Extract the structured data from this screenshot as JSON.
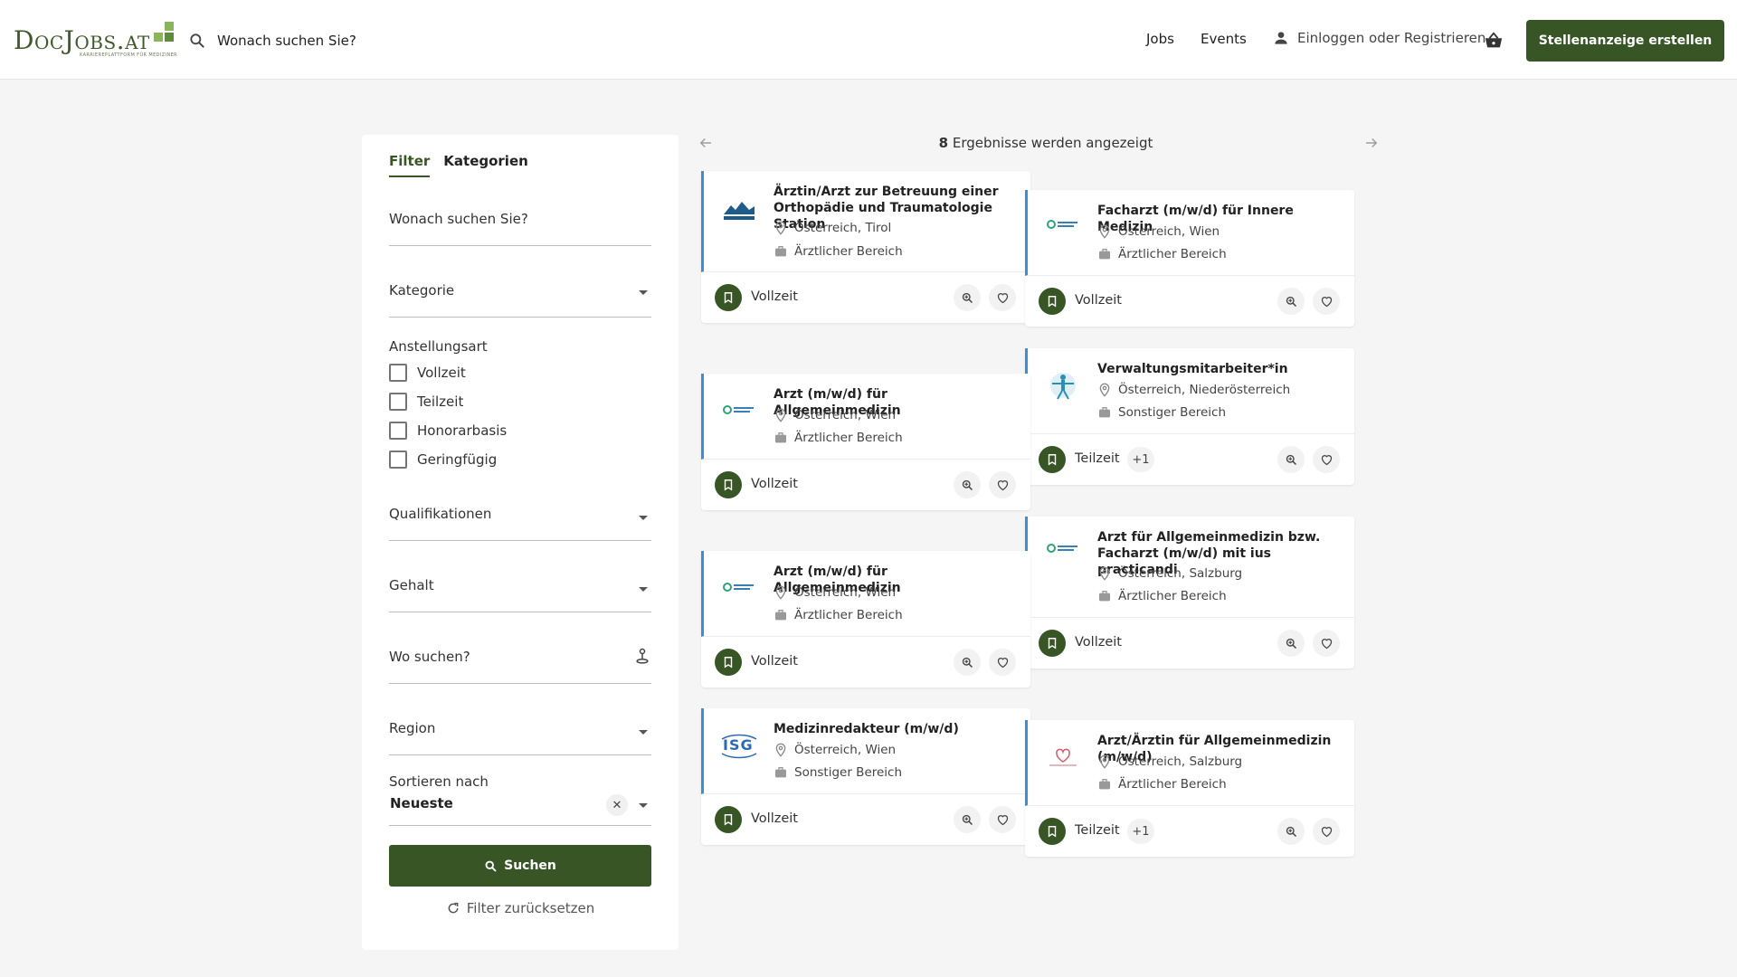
{
  "header": {
    "logo_text": "DocJobs.at",
    "logo_tagline": "KARRIEREPLATTFORM FÜR MEDIZINER",
    "search_placeholder": "Wonach suchen Sie?",
    "nav_jobs": "Jobs",
    "nav_events": "Events",
    "login": "Einloggen oder Registrieren",
    "cta": "Stellenanzeige erstellen"
  },
  "filter": {
    "tabs": [
      "Filter",
      "Kategorien"
    ],
    "search_placeholder": "Wonach suchen Sie?",
    "kategorie": "Kategorie",
    "anstellungsart_label": "Anstellungsart",
    "anstellungsart_options": [
      "Vollzeit",
      "Teilzeit",
      "Honorarbasis",
      "Geringfügig"
    ],
    "qualifikationen": "Qualifikationen",
    "gehalt": "Gehalt",
    "wo_suchen": "Wo suchen?",
    "region": "Region",
    "sort_label": "Sortieren nach",
    "sort_value": "Neueste",
    "search_button": "Suchen",
    "reset": "Filter zurücksetzen"
  },
  "results": {
    "count": "8",
    "count_text": " Ergebnisse werden angezeigt"
  },
  "jobs": [
    {
      "title": "Ärztin/Arzt zur Betreuung einer Orthopädie und Traumatologie Station",
      "location": "Österreich, Tirol",
      "category": "Ärztlicher Bereich",
      "type": "Vollzeit",
      "extra": "",
      "logo": "tirol-kliniken-logo"
    },
    {
      "title": "Facharzt (m/w/d) für Innere Medizin",
      "location": "Österreich, Wien",
      "category": "Ärztlicher Bereich",
      "type": "Vollzeit",
      "extra": "",
      "logo": "green-ring-logo"
    },
    {
      "title": "Verwaltungsmitarbeiter*in",
      "location": "Österreich, Niederösterreich",
      "category": "Sonstiger Bereich",
      "type": "Teilzeit",
      "extra": "+1",
      "logo": "vitruvian-logo"
    },
    {
      "title": "Arzt (m/w/d) für Allgemeinmedizin",
      "location": "Österreich, Wien",
      "category": "Ärztlicher Bereich",
      "type": "Vollzeit",
      "extra": "",
      "logo": "green-ring-logo"
    },
    {
      "title": "Arzt für Allgemeinmedizin bzw. Facharzt (m/w/d) mit ius practicandi",
      "location": "Österreich, Salzburg",
      "category": "Ärztlicher Bereich",
      "type": "Vollzeit",
      "extra": "",
      "logo": "green-ring-logo"
    },
    {
      "title": "Arzt (m/w/d) für Allgemeinmedizin",
      "location": "Österreich, Wien",
      "category": "Ärztlicher Bereich",
      "type": "Vollzeit",
      "extra": "",
      "logo": "green-ring-logo"
    },
    {
      "title": "Medizinredakteur (m/w/d)",
      "location": "Österreich, Wien",
      "category": "Sonstiger Bereich",
      "type": "Vollzeit",
      "extra": "",
      "logo": "isg-logo"
    },
    {
      "title": "Arzt/Ärztin für Allgemeinmedizin (m/w/d)",
      "location": "Österreich, Salzburg",
      "category": "Ärztlicher Bereich",
      "type": "Teilzeit",
      "extra": "+1",
      "logo": "heart-logo"
    }
  ]
}
